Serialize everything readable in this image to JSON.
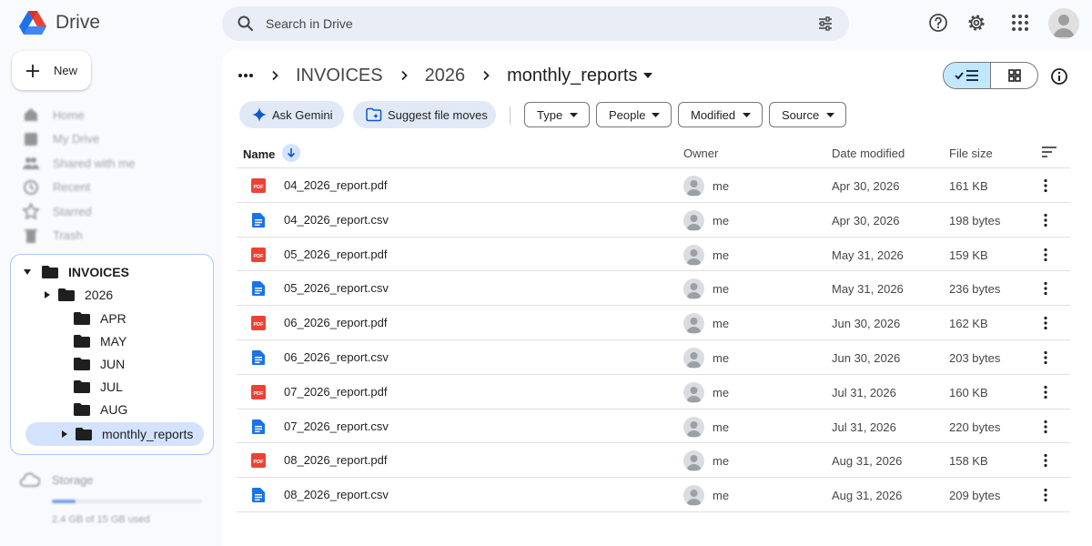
{
  "app": {
    "name": "Drive"
  },
  "search": {
    "placeholder": "Search in Drive"
  },
  "sidebar": {
    "new_label": "New",
    "nav": [
      {
        "label": "Home",
        "icon": "home-icon"
      },
      {
        "label": "My Drive",
        "icon": "my-drive-icon"
      },
      {
        "label": "Shared with me",
        "icon": "people-icon"
      },
      {
        "label": "Recent",
        "icon": "clock-icon"
      },
      {
        "label": "Starred",
        "icon": "star-icon"
      },
      {
        "label": "Trash",
        "icon": "trash-icon"
      }
    ],
    "tree": {
      "root": "INVOICES",
      "year": "2026",
      "months": [
        "APR",
        "MAY",
        "JUN",
        "JUL",
        "AUG"
      ],
      "selected": "monthly_reports"
    },
    "storage": {
      "label": "Storage",
      "used_text": "2.4 GB of 15 GB used",
      "used_fraction": 0.16
    }
  },
  "breadcrumb": {
    "items": [
      "INVOICES",
      "2026"
    ],
    "current": "monthly_reports"
  },
  "actions": {
    "ask_gemini": "Ask Gemini",
    "suggest_moves": "Suggest file moves"
  },
  "filters": {
    "type": "Type",
    "people": "People",
    "modified": "Modified",
    "source": "Source"
  },
  "table": {
    "headers": {
      "name": "Name",
      "owner": "Owner",
      "date": "Date modified",
      "size": "File size"
    },
    "rows": [
      {
        "name": "04_2026_report.pdf",
        "type": "pdf",
        "owner": "me",
        "date": "Apr 30, 2026",
        "size": "161 KB"
      },
      {
        "name": "04_2026_report.csv",
        "type": "csv",
        "owner": "me",
        "date": "Apr 30, 2026",
        "size": "198 bytes"
      },
      {
        "name": "05_2026_report.pdf",
        "type": "pdf",
        "owner": "me",
        "date": "May 31, 2026",
        "size": "159 KB"
      },
      {
        "name": "05_2026_report.csv",
        "type": "csv",
        "owner": "me",
        "date": "May 31, 2026",
        "size": "236 bytes"
      },
      {
        "name": "06_2026_report.pdf",
        "type": "pdf",
        "owner": "me",
        "date": "Jun 30, 2026",
        "size": "162 KB"
      },
      {
        "name": "06_2026_report.csv",
        "type": "csv",
        "owner": "me",
        "date": "Jun 30, 2026",
        "size": "203 bytes"
      },
      {
        "name": "07_2026_report.pdf",
        "type": "pdf",
        "owner": "me",
        "date": "Jul 31, 2026",
        "size": "160 KB"
      },
      {
        "name": "07_2026_report.csv",
        "type": "csv",
        "owner": "me",
        "date": "Jul 31, 2026",
        "size": "220 bytes"
      },
      {
        "name": "08_2026_report.pdf",
        "type": "pdf",
        "owner": "me",
        "date": "Aug 31, 2026",
        "size": "158 KB"
      },
      {
        "name": "08_2026_report.csv",
        "type": "csv",
        "owner": "me",
        "date": "Aug 31, 2026",
        "size": "209 bytes"
      }
    ]
  },
  "colors": {
    "accent": "#0b57d0",
    "selected_bg": "#c2e7ff",
    "pdf_red": "#ea4335",
    "doc_blue": "#1a73e8"
  }
}
